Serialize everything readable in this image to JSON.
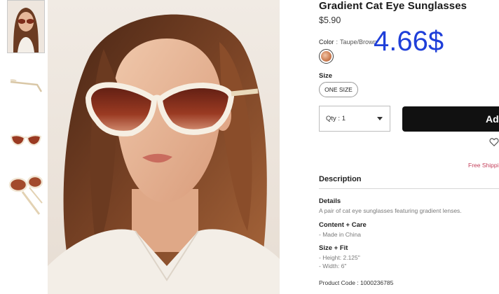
{
  "product": {
    "title": "Gradient Cat Eye Sunglasses",
    "price": "$5.90",
    "overlay_price": "4.66$",
    "color_label": "Color",
    "color_separator": ":",
    "color_value": "Taupe/Brown",
    "size_label": "Size",
    "size_option": "ONE SIZE",
    "qty_label": "Qty : 1",
    "add_button_label": "Add",
    "free_shipping": "Free Shipping",
    "description_title": "Description",
    "details_heading": "Details",
    "details_text": "A pair of cat eye sunglasses featuring gradient lenses.",
    "content_heading": "Content + Care",
    "content_text": "- Made in China",
    "fit_heading": "Size + Fit",
    "fit_height": "- Height: 2.125\"",
    "fit_width": "- Width: 6\"",
    "product_code": "Product Code : 1000236785"
  },
  "colors": {
    "lens": "#9a3a22",
    "frame": "#f3ecdf",
    "accent_pink": "#c4405b",
    "overlay_blue": "#1f3fd9",
    "button": "#111111"
  },
  "icons": {
    "heart": "heart-outline-icon",
    "dropdown": "chevron-down-icon"
  }
}
